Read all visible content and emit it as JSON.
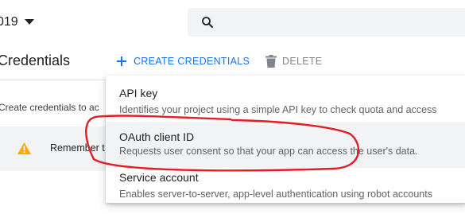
{
  "header": {
    "project_name": "019",
    "icons": {
      "dropdown": "caret-down-icon",
      "search": "search-icon"
    }
  },
  "toolbar": {
    "title": "Credentials",
    "create_label": "CREATE CREDENTIALS",
    "delete_label": "DELETE",
    "icons": {
      "create": "plus-icon",
      "delete": "trash-icon"
    }
  },
  "main": {
    "helper_text": "Create credentials to ac",
    "banner": {
      "text": "Remember t",
      "icon": "warning-icon"
    }
  },
  "menu": {
    "items": [
      {
        "title": "API key",
        "description": "Identifies your project using a simple API key to check quota and access"
      },
      {
        "title": "OAuth client ID",
        "description": "Requests user consent so that your app can access the user's data."
      },
      {
        "title": "Service account",
        "description": "Enables server-to-server, app-level authentication using robot accounts"
      }
    ]
  },
  "colors": {
    "accent": "#1a73e8",
    "disabled": "#80868b",
    "warning": "#f9ab00",
    "annotation": "#e51c23",
    "panel": "#f1f3f4"
  }
}
